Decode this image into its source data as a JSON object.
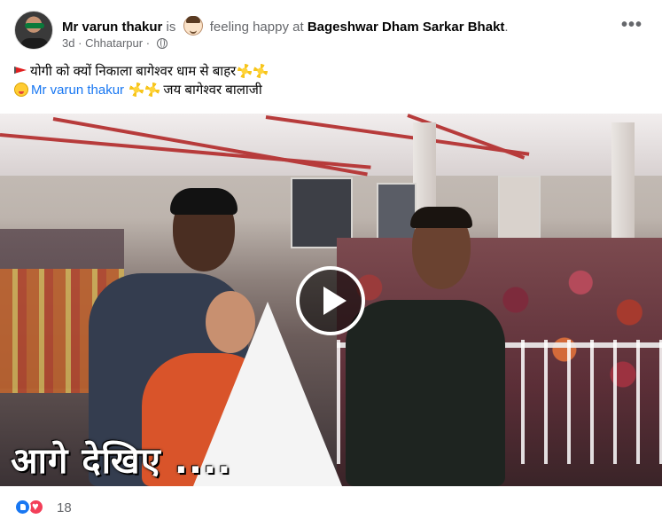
{
  "post": {
    "author": "Mr varun thakur",
    "is_word": "is",
    "feeling": "feeling happy at",
    "place": "Bageshwar Dham Sarkar Bhakt",
    "period": ".",
    "time": "3d",
    "separator": "·",
    "location": "Chhatarpur",
    "separator2": "·",
    "more_label": "•••",
    "text_line1": "योगी को क्यों निकाला बागेश्वर धाम से बाहर",
    "text_line2_mention": "Mr varun thakur",
    "text_line2_rest": "जय बागेश्वर बालाजी"
  },
  "video": {
    "overlay_caption": "आगे देखिए ....",
    "play_icon": "play-icon"
  },
  "reactions": {
    "icons": [
      "like-icon",
      "love-icon"
    ],
    "count": "18"
  },
  "colors": {
    "link": "#1877f2",
    "muted": "#65676b",
    "like": "#1877f2",
    "love": "#f33e58"
  }
}
